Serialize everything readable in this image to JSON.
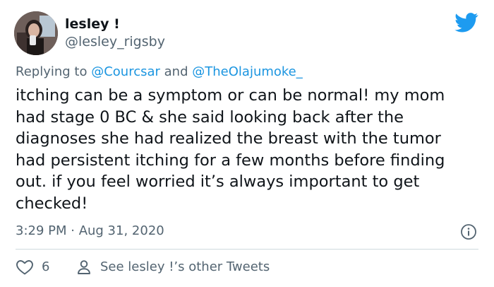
{
  "author": {
    "display_name": "lesley !",
    "handle": "@lesley_rigsby",
    "avatar_icon": "profile-photo"
  },
  "reply": {
    "prefix": "Replying to",
    "mention_1": "@Courcsar",
    "conjunction": "and",
    "mention_2": "@TheOlajumoke_"
  },
  "body": {
    "lines": [
      "itching can be a symptom or can be normal! my mom",
      "had stage 0 BC & she said looking back after the",
      "diagnoses she had realized the breast with the tumor",
      "had persistent itching for a few months before finding",
      "out. if you feel worried it’s always important to get",
      "checked!"
    ]
  },
  "meta": {
    "timestamp": "3:29 PM · Aug 31, 2020"
  },
  "actions": {
    "like_count": "6",
    "profile_link": "See lesley !’s other Tweets"
  },
  "colors": {
    "brand": "#1d9bf0",
    "mention": "#1b95e0",
    "secondary_text": "#536471",
    "primary_text": "#0f1419",
    "divider": "#cfd9de"
  },
  "icons": {
    "brand_logo": "twitter-bird-icon",
    "info": "info-icon",
    "like": "heart-icon",
    "profile": "user-icon"
  }
}
